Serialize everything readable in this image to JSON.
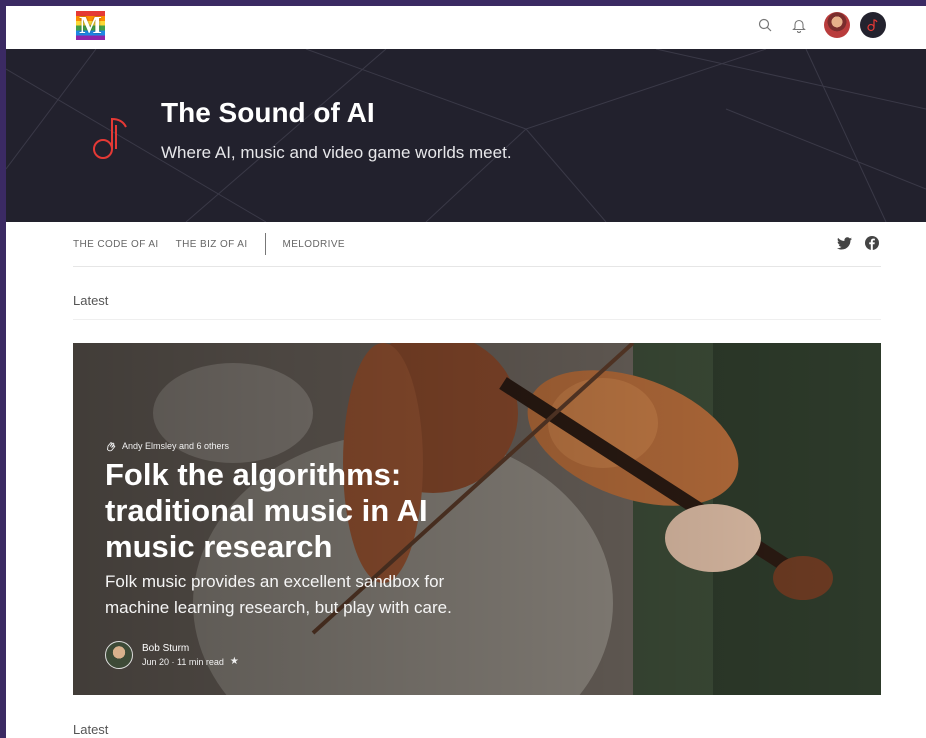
{
  "topbar": {
    "logo_letter": "M",
    "icons": [
      "search-icon",
      "bell-icon",
      "user-avatar",
      "publication-avatar"
    ]
  },
  "publication": {
    "title": "The Sound of AI",
    "tagline": "Where AI, music and video game worlds meet."
  },
  "nav": {
    "items": [
      "THE CODE OF AI",
      "THE BIZ OF AI",
      "MELODRIVE"
    ],
    "social": [
      "twitter-icon",
      "facebook-icon"
    ]
  },
  "sections": {
    "latest_top": "Latest",
    "latest_bottom": "Latest"
  },
  "featured": {
    "recommended_by": "Andy Elmsley and 6 others",
    "title": "Folk the algorithms: traditional music in AI music research",
    "subtitle": "Folk music provides an excellent sandbox for machine learning research, but play with care.",
    "author": "Bob Sturm",
    "meta": "Jun 20 · 11 min read",
    "star": "★"
  },
  "colors": {
    "page_bg": "#3b2a63",
    "hero_bg": "#22212d",
    "accent_red": "#e53935"
  }
}
